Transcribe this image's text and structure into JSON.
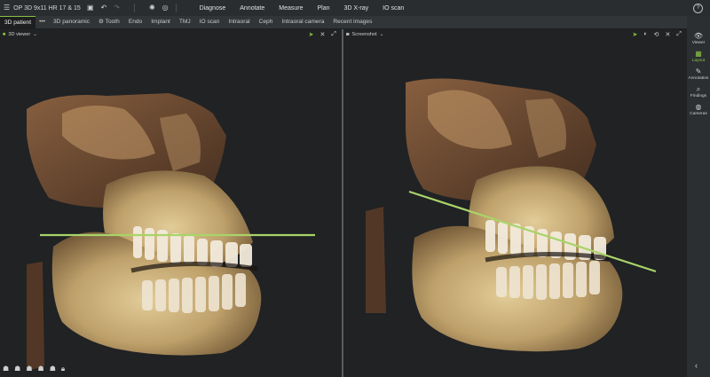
{
  "app": {
    "title": "OP 3D 9x11 HR 17 & 15",
    "help_label": "?"
  },
  "toolbar": {
    "icons": [
      "hamburger-menu-icon",
      "save-icon",
      "undo-icon",
      "redo-icon",
      "settings-icon",
      "target-icon"
    ]
  },
  "main_menu": [
    "Diagnose",
    "Annotate",
    "Measure",
    "Plan",
    "3D X-ray",
    "IO scan"
  ],
  "tabs": {
    "active": "3D patient",
    "more": "•••",
    "items": [
      "3D panoramic",
      "Tooth",
      "Endo",
      "Implant",
      "TMJ",
      "IO scan",
      "Intraoral",
      "Ceph",
      "Intraoral camera",
      "Recent images"
    ]
  },
  "viewports": {
    "left": {
      "label": "3D viewer"
    },
    "right": {
      "label": "Screenshot"
    }
  },
  "sidebar": {
    "items": [
      {
        "label": "Viewer",
        "icon": "eye-icon",
        "glyph": "👁"
      },
      {
        "label": "Layout",
        "icon": "layout-icon",
        "glyph": "▦"
      },
      {
        "label": "Annotation",
        "icon": "pencil-icon",
        "glyph": "✎"
      },
      {
        "label": "Findings",
        "icon": "findings-icon",
        "glyph": "⌕"
      },
      {
        "label": "Cameras",
        "icon": "camera-icon",
        "glyph": "◍"
      }
    ],
    "active": "Layout",
    "collapse": "‹"
  },
  "colors": {
    "accent": "#8ac342",
    "line": "#a9d46a",
    "bone": "#c8aa78",
    "bg": "#202224"
  }
}
